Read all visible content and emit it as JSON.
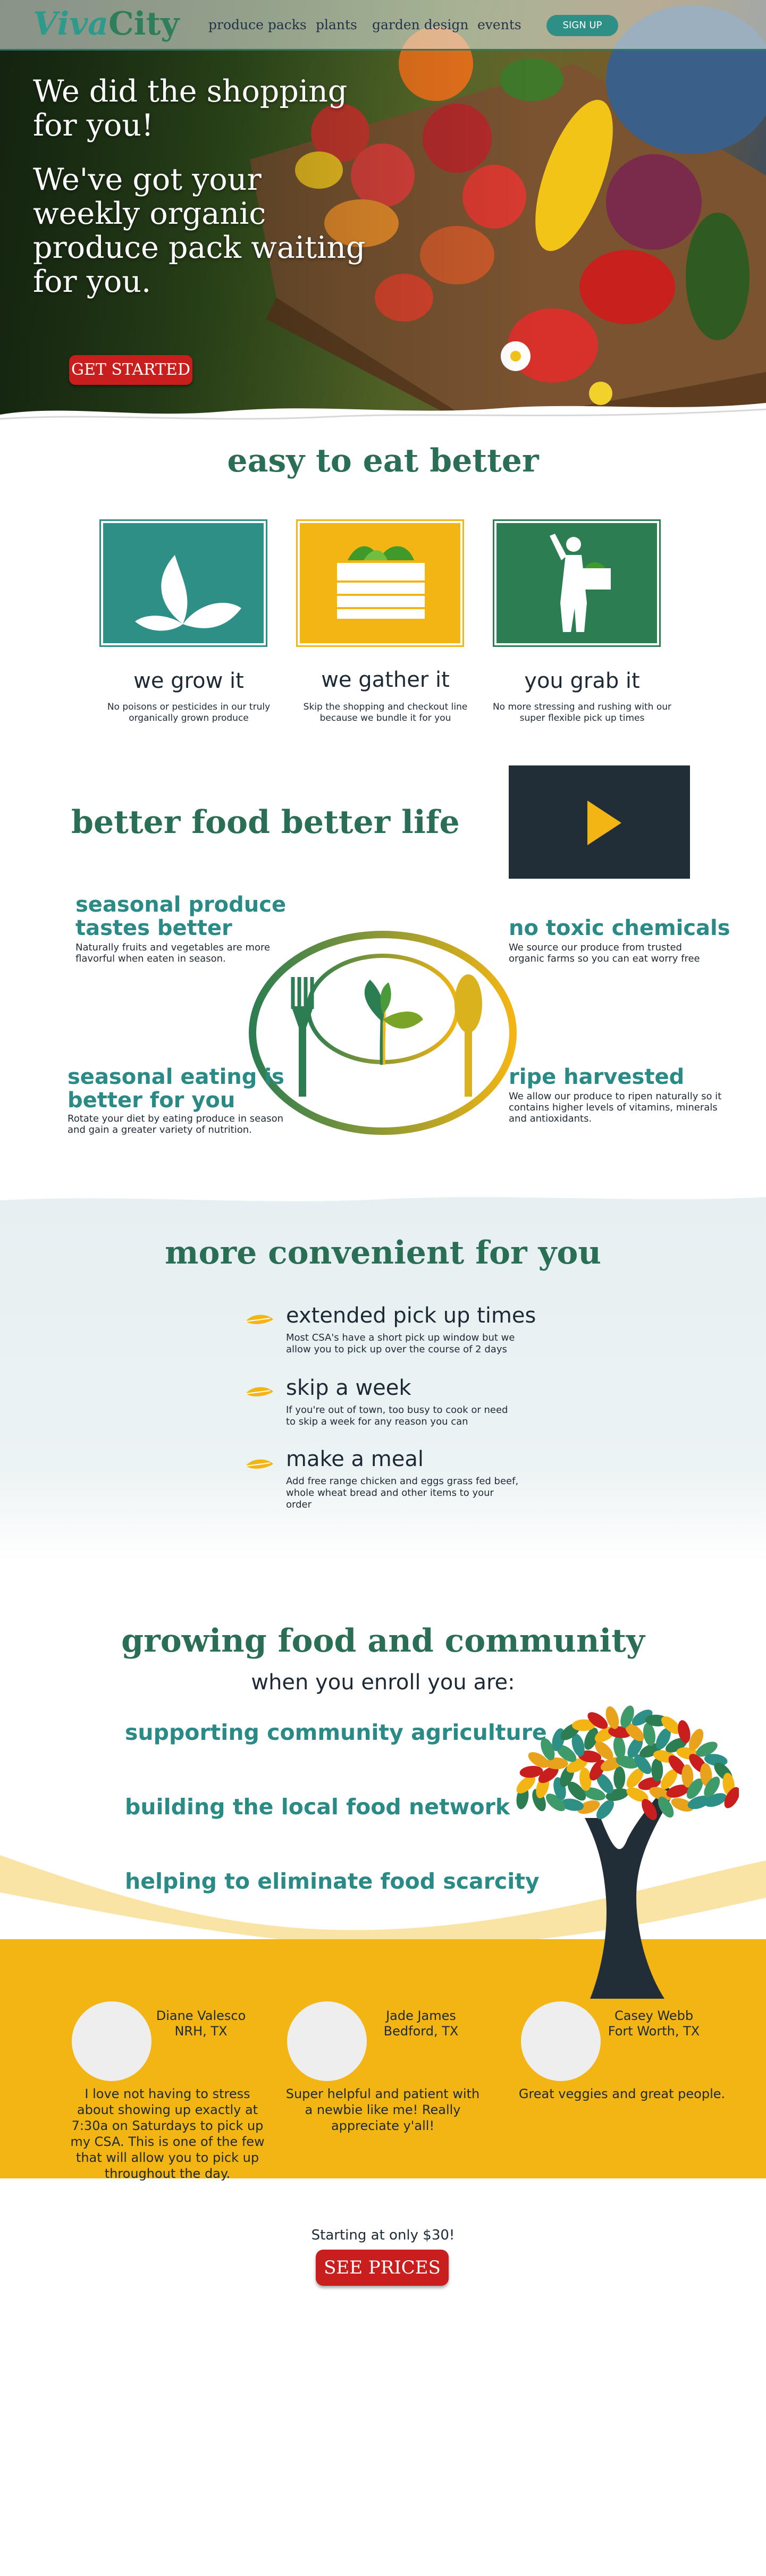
{
  "brand": {
    "logo_part1": "iva",
    "logo_initial": "V",
    "logo_part2": "City"
  },
  "nav": {
    "links": [
      "produce packs",
      "plants",
      "garden design",
      "events"
    ],
    "signup_label": "SIGN UP"
  },
  "hero": {
    "headline_1": "We did the shopping for you!",
    "headline_2": "We've got your weekly organic produce pack waiting for you.",
    "cta_label": "GET STARTED"
  },
  "easy": {
    "title": "easy to eat better",
    "features": [
      {
        "title": "we grow it",
        "desc": "No poisons or pesticides in our truly organically grown produce",
        "color": "#2e8f86",
        "icon": "leaves-icon"
      },
      {
        "title": "we gather it",
        "desc": "Skip the shopping and checkout line because we bundle it for you",
        "color": "#f3b514",
        "icon": "produce-box-icon"
      },
      {
        "title": "you grab it",
        "desc": "No more stressing and rushing with our super flexible pick up times",
        "color": "#2c7d52",
        "icon": "person-carrying-box-icon"
      }
    ]
  },
  "better": {
    "title": "better food better life",
    "items": [
      {
        "title": "seasonal produce tastes better",
        "desc": "Naturally fruits and vegetables are more flavorful when eaten in season."
      },
      {
        "title": "no toxic chemicals",
        "desc": "We source our produce from trusted organic farms so you can eat worry free"
      },
      {
        "title": "seasonal eating is better for you",
        "desc": "Rotate your diet by eating produce in season and gain a greater variety of nutrition."
      },
      {
        "title": "ripe harvested",
        "desc": "We allow our produce to ripen naturally so it contains higher levels of vitamins, minerals and antioxidants."
      }
    ]
  },
  "convenient": {
    "title": "more convenient for you",
    "items": [
      {
        "title": "extended pick up times",
        "desc": "Most CSA's have a short pick up window but we allow you to pick up over the course of 2 days"
      },
      {
        "title": "skip a week",
        "desc": "If you're out of town, too busy to cook or need to skip a week for any reason you can"
      },
      {
        "title": "make a meal",
        "desc": "Add free range chicken and eggs grass fed beef, whole wheat bread and other items to your order"
      }
    ]
  },
  "community": {
    "title": "growing food and community",
    "subtitle": "when you enroll you are:",
    "items": [
      "supporting community agriculture",
      "building the local food network",
      "helping to eliminate food scarcity"
    ]
  },
  "testimonials": [
    {
      "name": "Diane Valesco",
      "location": "NRH, TX",
      "quote": "I love not having to stress about showing up exactly at 7:30a on Saturdays to pick up my CSA. This is one of the few that will allow you to pick up throughout the day."
    },
    {
      "name": "Jade James",
      "location": "Bedford, TX",
      "quote": "Super helpful and patient with a newbie like me! Really appreciate y'all!"
    },
    {
      "name": "Casey Webb",
      "location": "Fort Worth, TX",
      "quote": "Great veggies and great people."
    }
  ],
  "pricing": {
    "starting_text": "Starting at only $30!",
    "cta_label": "SEE PRICES"
  },
  "colors": {
    "teal": "#2e8f86",
    "green": "#2c7d52",
    "yellow": "#f3b514",
    "red": "#c81e1e",
    "dark": "#222e37"
  }
}
